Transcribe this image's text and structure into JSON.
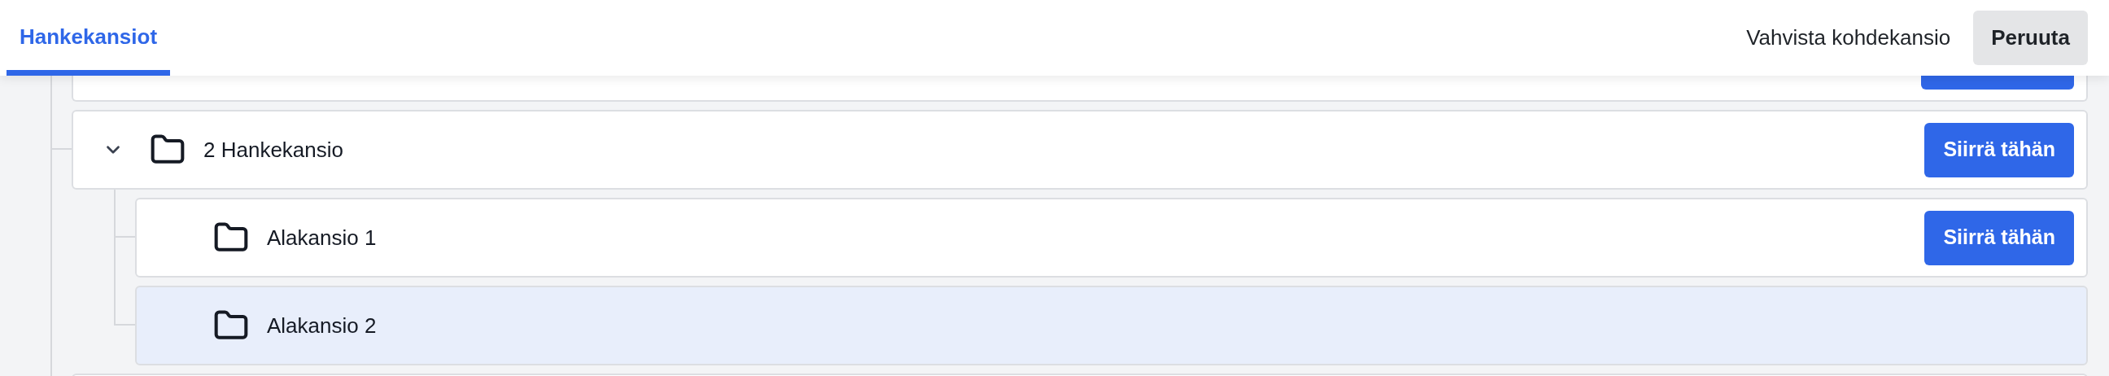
{
  "tabs": [
    {
      "label": "Hankekansiot",
      "selected": true
    }
  ],
  "actions": [
    {
      "label": "Vahvista kohdekansio",
      "kind": "text"
    },
    {
      "label": "Peruuta",
      "kind": "secondary"
    }
  ],
  "folders": [
    {
      "kind": "obscured",
      "move_button": true
    },
    {
      "kind": "folder",
      "name": "2 Hankekansio",
      "expanded": true,
      "selected": false,
      "move_label": "Siirrä tähän",
      "children": [
        {
          "kind": "folder",
          "name": "Alakansio 1",
          "selected": false,
          "move_label": "Siirrä tähän"
        },
        {
          "kind": "folder",
          "name": "Alakansio 2",
          "selected": true
        }
      ]
    },
    {
      "kind": "obscured"
    }
  ]
}
